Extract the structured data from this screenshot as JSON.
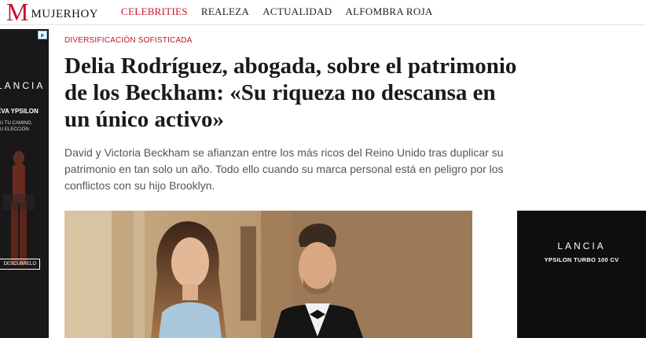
{
  "header": {
    "logo_mark": "M",
    "logo_text": "MUJERHOY",
    "nav": [
      {
        "label": "CELEBRITIES",
        "active": true
      },
      {
        "label": "REALEZA",
        "active": false
      },
      {
        "label": "ACTUALIDAD",
        "active": false
      },
      {
        "label": "ALFOMBRA ROJA",
        "active": false
      }
    ]
  },
  "ad_left": {
    "brand": "LANCIA",
    "model": "EVA YPSILON",
    "tagline_1": "U TU CAMINO,",
    "tagline_2": "U ELECCIÓN",
    "cta": "DESCÚBRELO",
    "adchoices_icon": "adchoices-icon"
  },
  "ad_right": {
    "brand": "LANCIA",
    "model": "YPSILON TURBO 100 CV"
  },
  "article": {
    "kicker": "DIVERSIFICACIÓN SOFISTICADA",
    "title": "Delia Rodríguez, abogada, sobre el patrimonio de los Beckham: «Su riqueza no descansa en un único activo»",
    "lead": "David y Victoria Beckham se afianzan entre los más ricos del Reino Unido tras duplicar su patrimonio en tan solo un año. Todo ello cuando su marca personal está en peligro por los conflictos con su hijo Brooklyn."
  },
  "colors": {
    "accent": "#c4122f",
    "ad_background": "#0e0e0e"
  }
}
